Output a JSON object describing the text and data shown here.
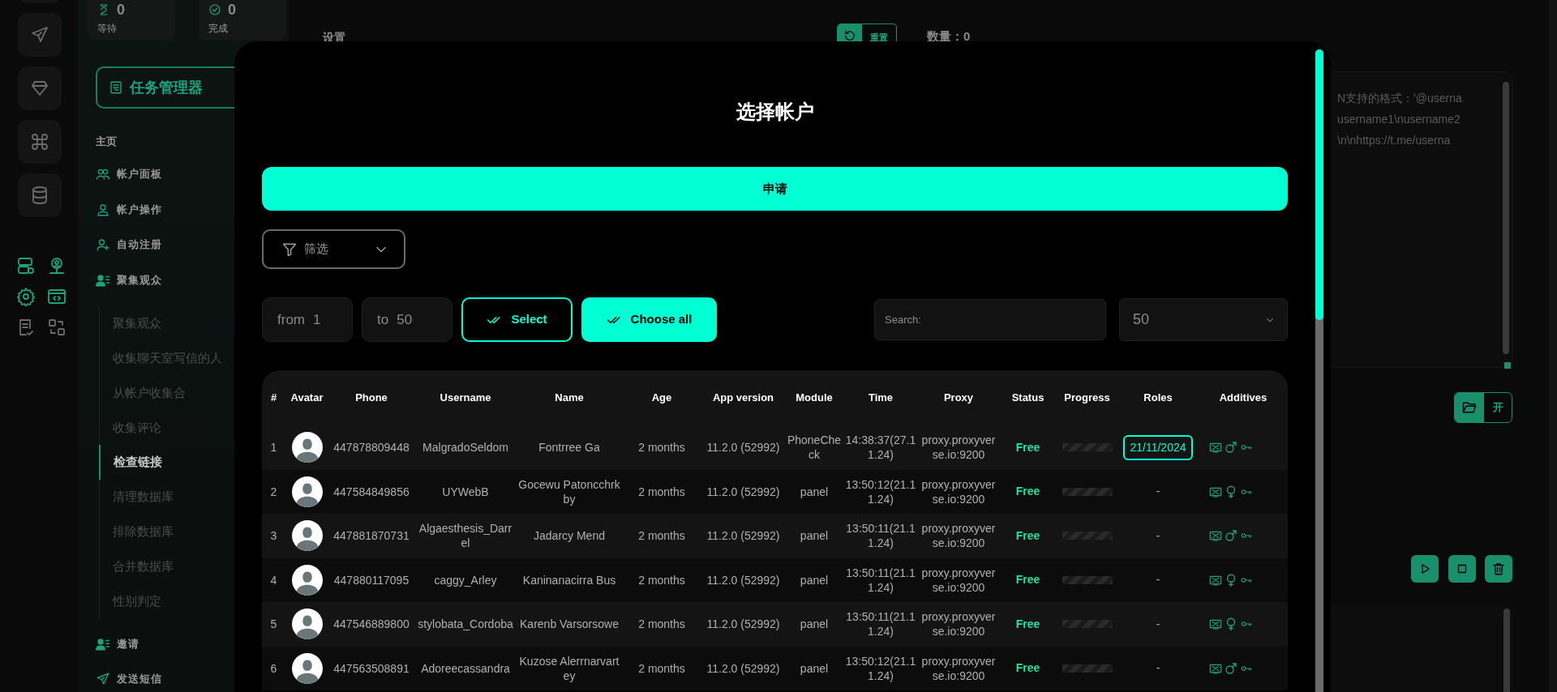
{
  "stats": [
    {
      "kind": "waiting",
      "value": "0",
      "label": "等待"
    },
    {
      "kind": "done",
      "value": "0",
      "label": "完成"
    }
  ],
  "rail": {
    "buttons": [
      {
        "kind": "send"
      },
      {
        "kind": "diamond"
      },
      {
        "kind": "command"
      },
      {
        "kind": "database"
      }
    ],
    "small_icons": [
      {
        "kind": "server"
      },
      {
        "kind": "user-pin"
      },
      {
        "kind": "gear"
      },
      {
        "kind": "code"
      },
      {
        "kind": "doc"
      },
      {
        "kind": "swap"
      }
    ]
  },
  "sidebar": {
    "task_manager": "任务管理器",
    "home": "主页",
    "items": [
      {
        "label": "帐户面板",
        "kind": "users"
      },
      {
        "label": "帐户操作",
        "kind": "user"
      },
      {
        "label": "自动注册",
        "kind": "user-plus"
      },
      {
        "label": "聚集观众",
        "kind": "user-list",
        "children": [
          {
            "label": "聚集观众",
            "selected": false
          },
          {
            "label": "收集聊天室写信的人",
            "selected": false
          },
          {
            "label": "从帐户收集合",
            "selected": false
          },
          {
            "label": "收集评论",
            "selected": false
          },
          {
            "label": "检查链接",
            "selected": true
          },
          {
            "label": "清理数据库",
            "selected": false
          },
          {
            "label": "排除数据库",
            "selected": false
          },
          {
            "label": "合并数据库",
            "selected": false
          },
          {
            "label": "性别判定",
            "selected": false
          }
        ]
      },
      {
        "label": "邀请",
        "kind": "user-list"
      },
      {
        "label": "发送短信",
        "kind": "send"
      }
    ]
  },
  "background": {
    "settings_title": "设置",
    "reset_button": "重置",
    "count": "数量：0",
    "textarea_lines": [
      "N支持的格式：'@userna",
      "username1\\nusername2",
      "\\n\\nhttps://t.me/userna"
    ],
    "open_button": "开"
  },
  "modal": {
    "title": "选择帐户",
    "apply_button": "申请",
    "filter": "筛选",
    "from_label": "from",
    "from_value": "1",
    "to_label": "to",
    "to_value": "50",
    "select_button": "Select",
    "choose_all_button": "Choose all",
    "search_placeholder": "Search:",
    "page_size": "50",
    "table": {
      "columns": [
        "#",
        "Avatar",
        "Phone",
        "Username",
        "Name",
        "Age",
        "App version",
        "Module",
        "Time",
        "Proxy",
        "Status",
        "Progress",
        "Roles",
        "Additives"
      ],
      "rows": [
        {
          "index": "1",
          "phone": "447878809448",
          "username": "MalgradoSeldom",
          "name": "Fontrree Ga",
          "age": "2 months",
          "app_version": "11.2.0 (52992)",
          "module": "PhoneCheck",
          "time": "14:38:37(27.11.24)",
          "proxy": "proxy.proxyverse.io:9200",
          "status": "Free",
          "progress": {
            "level": 0
          },
          "roles": "21/11/2024",
          "roles_badge": true,
          "additives": [
            {
              "kind": "screen"
            },
            {
              "kind": "male"
            },
            {
              "kind": "key"
            }
          ]
        },
        {
          "index": "2",
          "phone": "447584849856",
          "username": "UYWebB",
          "name": "Gocewu Patoncchrkby",
          "age": "2 months",
          "app_version": "11.2.0 (52992)",
          "module": "panel",
          "time": "13:50:12(21.11.24)",
          "proxy": "proxy.proxyverse.io:9200",
          "status": "Free",
          "progress": {
            "level": 0
          },
          "roles": "-",
          "roles_badge": false,
          "additives": [
            {
              "kind": "screen"
            },
            {
              "kind": "female"
            },
            {
              "kind": "key"
            }
          ]
        },
        {
          "index": "3",
          "phone": "447881870731",
          "username": "Algaesthesis_Darrel",
          "name": "Jadarcy Mend",
          "age": "2 months",
          "app_version": "11.2.0 (52992)",
          "module": "panel",
          "time": "13:50:11(21.11.24)",
          "proxy": "proxy.proxyverse.io:9200",
          "status": "Free",
          "progress": {
            "level": 0
          },
          "roles": "-",
          "roles_badge": false,
          "additives": [
            {
              "kind": "screen"
            },
            {
              "kind": "male"
            },
            {
              "kind": "key"
            }
          ]
        },
        {
          "index": "4",
          "phone": "447880117095",
          "username": "caggy_Arley",
          "name": "Kaninanacirra Bus",
          "age": "2 months",
          "app_version": "11.2.0 (52992)",
          "module": "panel",
          "time": "13:50:11(21.11.24)",
          "proxy": "proxy.proxyverse.io:9200",
          "status": "Free",
          "progress": {
            "level": 0
          },
          "roles": "-",
          "roles_badge": false,
          "additives": [
            {
              "kind": "screen"
            },
            {
              "kind": "female"
            },
            {
              "kind": "key"
            }
          ]
        },
        {
          "index": "5",
          "phone": "447546889800",
          "username": "stylobata_Cordoba",
          "name": "Karenb Varsorsowe",
          "age": "2 months",
          "app_version": "11.2.0 (52992)",
          "module": "panel",
          "time": "13:50:11(21.11.24)",
          "proxy": "proxy.proxyverse.io:9200",
          "status": "Free",
          "progress": {
            "level": 0
          },
          "roles": "-",
          "roles_badge": false,
          "additives": [
            {
              "kind": "screen"
            },
            {
              "kind": "female"
            },
            {
              "kind": "key"
            }
          ]
        },
        {
          "index": "6",
          "phone": "447563508891",
          "username": "Adoreecassandra",
          "name": "Kuzose Alerrnarvartey",
          "age": "2 months",
          "app_version": "11.2.0 (52992)",
          "module": "panel",
          "time": "13:50:12(21.11.24)",
          "proxy": "proxy.proxyverse.io:9200",
          "status": "Free",
          "progress": {
            "level": 0
          },
          "roles": "-",
          "roles_badge": false,
          "additives": [
            {
              "kind": "screen"
            },
            {
              "kind": "male"
            },
            {
              "kind": "key"
            }
          ]
        }
      ]
    }
  }
}
